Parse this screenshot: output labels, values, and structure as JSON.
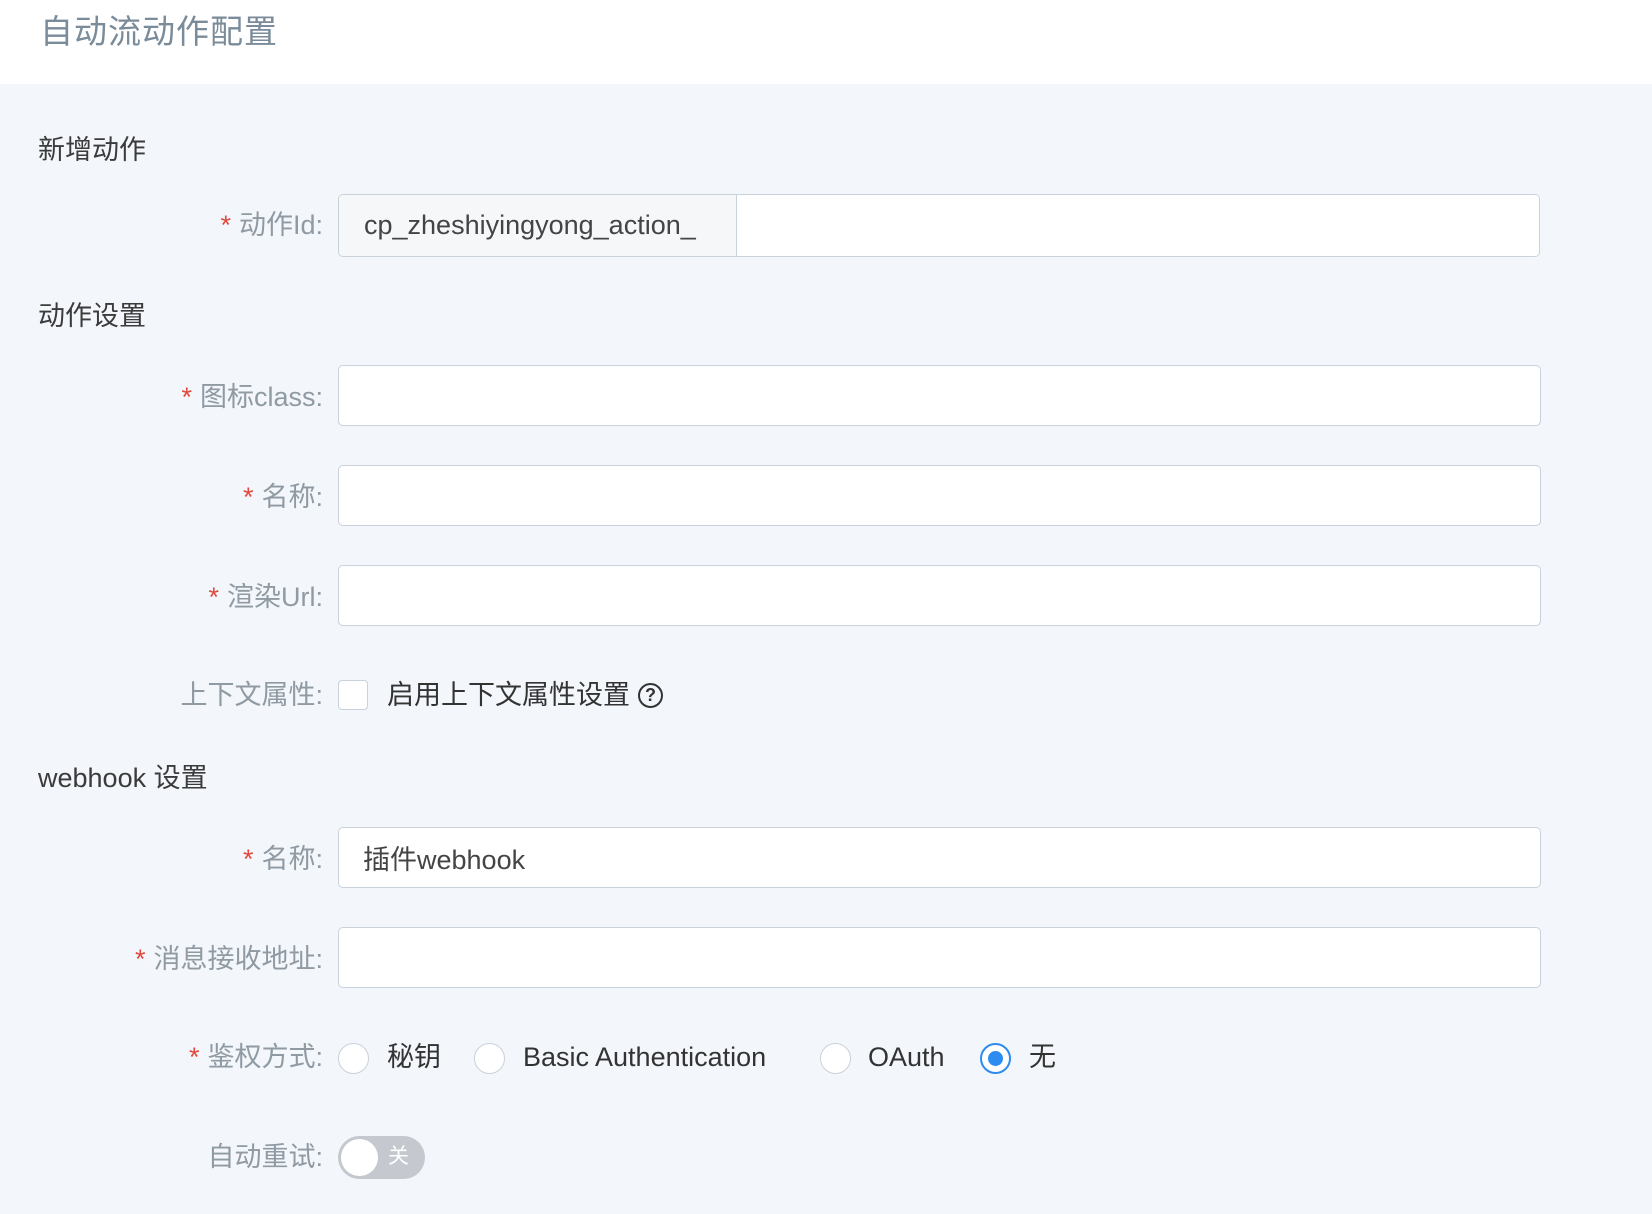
{
  "header": {
    "title": "自动流动作配置"
  },
  "sections": {
    "new_action": "新增动作",
    "action_settings": "动作设置",
    "webhook_settings": "webhook 设置"
  },
  "fields": {
    "action_id": {
      "label": "动作Id",
      "prefix": "cp_zheshiyingyong_action_",
      "value": ""
    },
    "icon_class": {
      "label": "图标class",
      "value": ""
    },
    "name": {
      "label": "名称",
      "value": ""
    },
    "render_url": {
      "label": "渲染Url",
      "value": ""
    },
    "context_attr": {
      "label": "上下文属性",
      "checkbox_label": "启用上下文属性设置",
      "checked": false
    },
    "webhook_name": {
      "label": "名称",
      "value": "插件webhook"
    },
    "message_url": {
      "label": "消息接收地址",
      "value": ""
    },
    "auth_method": {
      "label": "鉴权方式",
      "options": [
        "秘钥",
        "Basic Authentication",
        "OAuth",
        "无"
      ],
      "selected": "无"
    },
    "auto_retry": {
      "label": "自动重试",
      "state_text": "关",
      "enabled": false
    }
  },
  "colors": {
    "accent": "#2d8cf0",
    "required": "#e04a3c",
    "background": "#f3f6fb"
  }
}
